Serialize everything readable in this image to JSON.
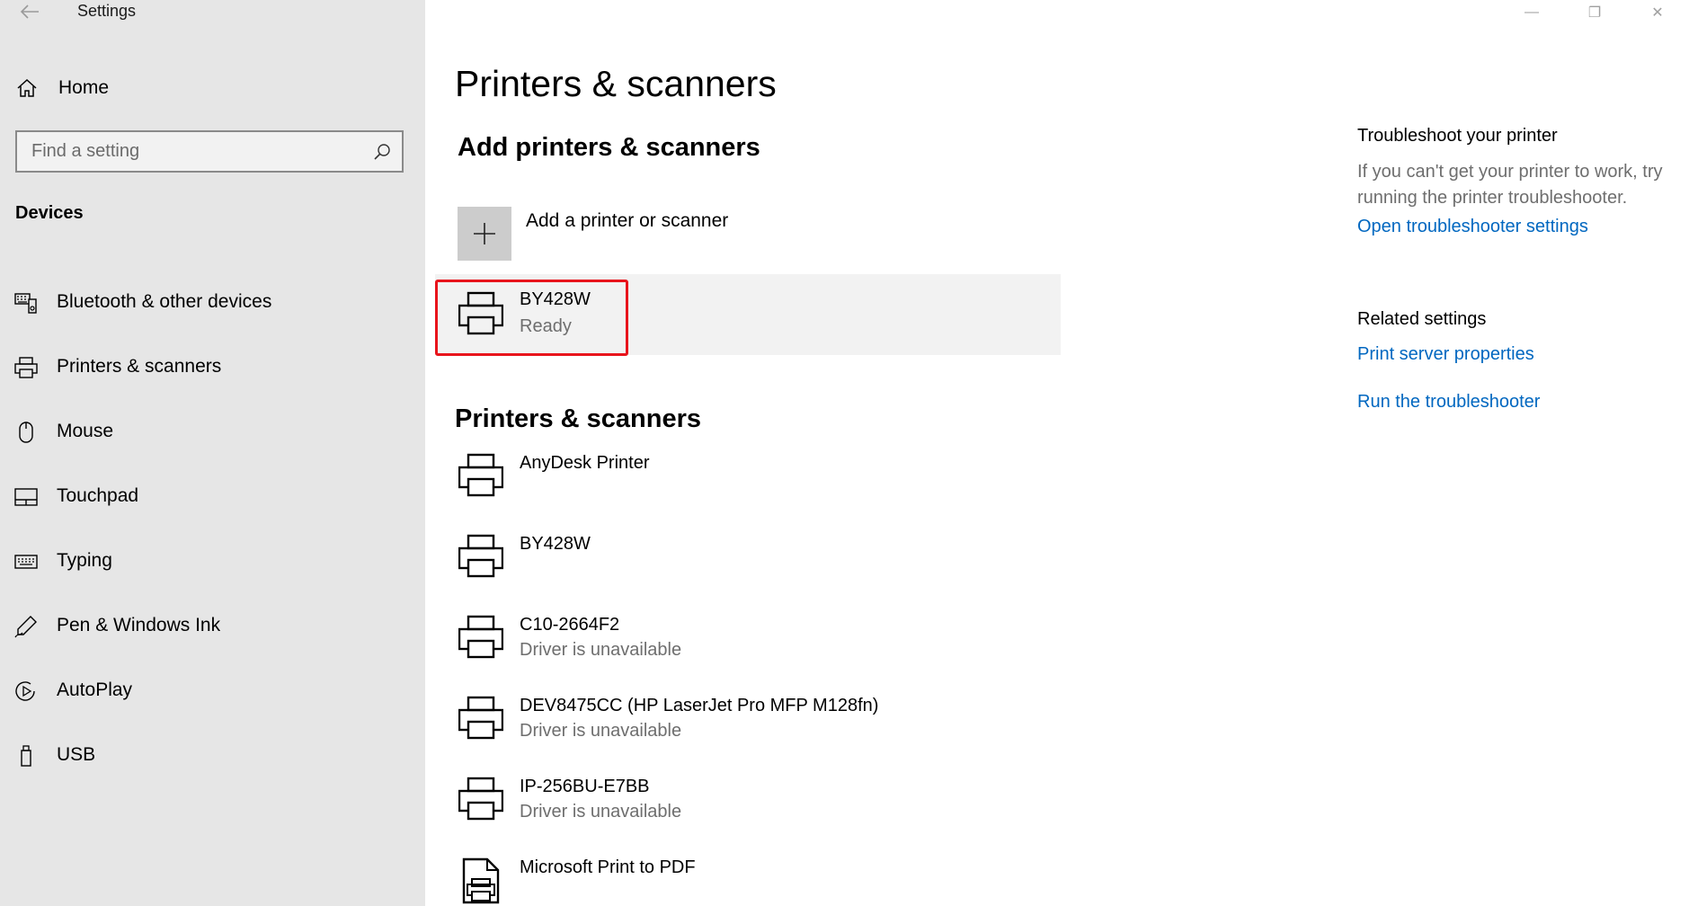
{
  "window": {
    "title": "Settings",
    "controls": {
      "minimize": "—",
      "maximize": "❐",
      "close": "✕"
    }
  },
  "sidebar": {
    "home_label": "Home",
    "search_placeholder": "Find a setting",
    "section_title": "Devices",
    "items": [
      {
        "label": "Bluetooth & other devices",
        "icon": "bluetooth-devices-icon"
      },
      {
        "label": "Printers & scanners",
        "icon": "printer-icon"
      },
      {
        "label": "Mouse",
        "icon": "mouse-icon"
      },
      {
        "label": "Touchpad",
        "icon": "touchpad-icon"
      },
      {
        "label": "Typing",
        "icon": "keyboard-icon"
      },
      {
        "label": "Pen & Windows Ink",
        "icon": "pen-icon"
      },
      {
        "label": "AutoPlay",
        "icon": "autoplay-icon"
      },
      {
        "label": "USB",
        "icon": "usb-icon"
      }
    ]
  },
  "main": {
    "page_title": "Printers & scanners",
    "add_section_title": "Add printers & scanners",
    "add_button_label": "Add a printer or scanner",
    "selected_device": {
      "name": "BY428W",
      "status": "Ready"
    },
    "list_title": "Printers & scanners",
    "printers": [
      {
        "name": "AnyDesk Printer",
        "status": "",
        "icon": "printer-icon"
      },
      {
        "name": "BY428W",
        "status": "",
        "icon": "printer-icon"
      },
      {
        "name": "C10-2664F2",
        "status": "Driver is unavailable",
        "icon": "printer-icon"
      },
      {
        "name": "DEV8475CC (HP LaserJet Pro MFP M128fn)",
        "status": "Driver is unavailable",
        "icon": "printer-icon"
      },
      {
        "name": "IP-256BU-E7BB",
        "status": "Driver is unavailable",
        "icon": "printer-icon"
      },
      {
        "name": "Microsoft Print to PDF",
        "status": "",
        "icon": "pdf-printer-icon"
      }
    ]
  },
  "right_panel": {
    "troubleshoot_title": "Troubleshoot your printer",
    "troubleshoot_desc": "If you can't get your printer to work, try running the printer troubleshooter.",
    "troubleshoot_link": "Open troubleshooter settings",
    "related_title": "Related settings",
    "related_links": [
      "Print server properties",
      "Run the troubleshooter"
    ]
  },
  "colors": {
    "sidebar_bg": "#e6e6e6",
    "accent_link": "#0067c0",
    "highlight_border": "#e8141c",
    "secondary_text": "#6e6e6e"
  }
}
